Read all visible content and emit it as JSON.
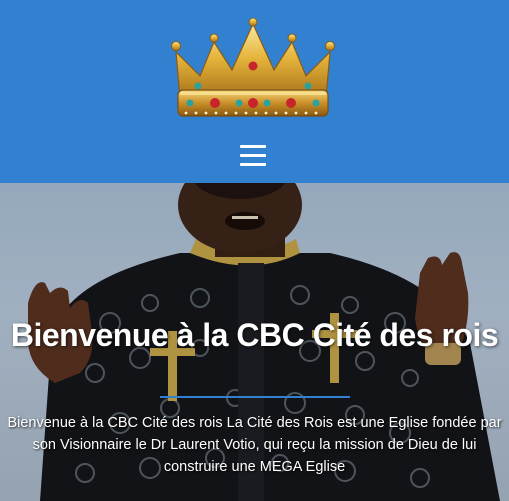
{
  "colors": {
    "header_bg": "#3181d0",
    "hero_text": "#ffffff",
    "accent_rule": "#3181d0"
  },
  "header": {
    "logo_icon": "crown-icon",
    "menu_icon": "hamburger-menu-icon"
  },
  "hero": {
    "title": "Bienvenue à la CBC Cité des rois",
    "text": "Bienvenue à la CBC Cité des rois La Cité des Rois est une Eglise fondée par son Visionnaire le Dr Laurent Votio, qui reçu la mission de Dieu de lui construire une MEGA Eglise"
  }
}
